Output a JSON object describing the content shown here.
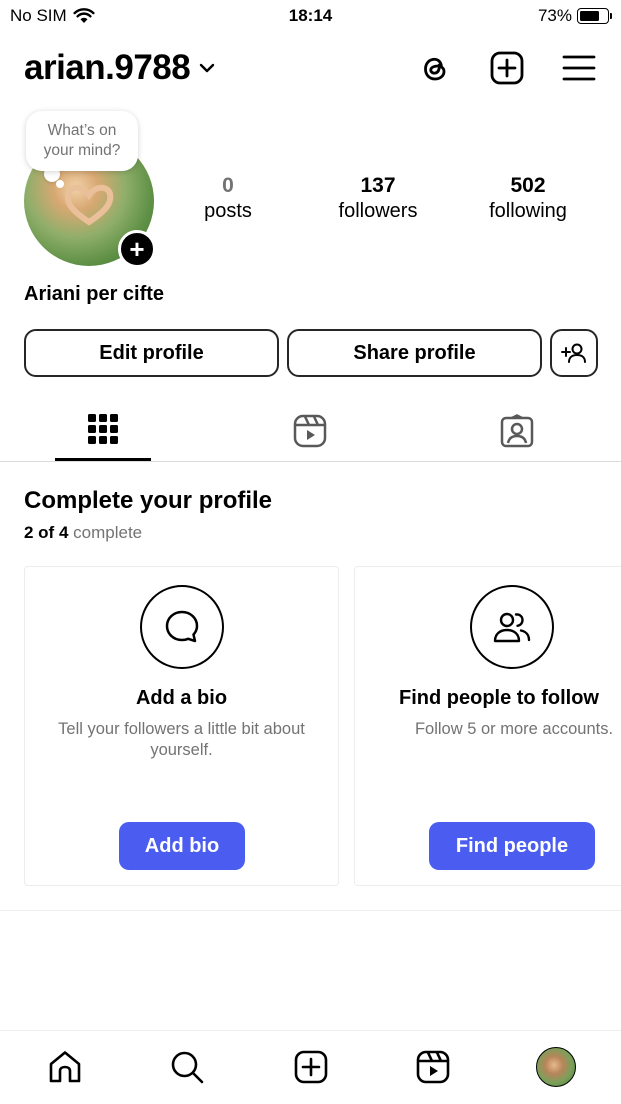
{
  "status_bar": {
    "carrier": "No SIM",
    "time": "18:14",
    "battery": "73%",
    "battery_level": 0.73
  },
  "header": {
    "username": "arian.9788",
    "icons": [
      "threads-icon",
      "create-post-icon",
      "menu-icon"
    ]
  },
  "profile": {
    "note_placeholder": "What’s on your mind?",
    "display_name": "Ariani per cifte",
    "stats": {
      "posts_count": "0",
      "posts_label": "posts",
      "followers_count": "137",
      "followers_label": "followers",
      "following_count": "502",
      "following_label": "following"
    },
    "buttons": {
      "edit": "Edit profile",
      "share": "Share profile"
    }
  },
  "tabs": [
    "grid-icon",
    "reels-icon",
    "tagged-icon"
  ],
  "complete_profile": {
    "title": "Complete your profile",
    "progress_done": "2 of 4",
    "progress_label": "complete",
    "cards": [
      {
        "title": "Add a bio",
        "description": "Tell your followers a little bit about yourself.",
        "button": "Add bio"
      },
      {
        "title": "Find people to follow",
        "description": "Follow 5 or more accounts.",
        "button": "Find people"
      }
    ]
  },
  "bottom_nav": [
    "home-icon",
    "search-icon",
    "create-icon",
    "reels-icon",
    "profile-avatar"
  ],
  "colors": {
    "accent": "#4a5df0",
    "muted_text": "#737373",
    "border": "#dbdbdb"
  }
}
